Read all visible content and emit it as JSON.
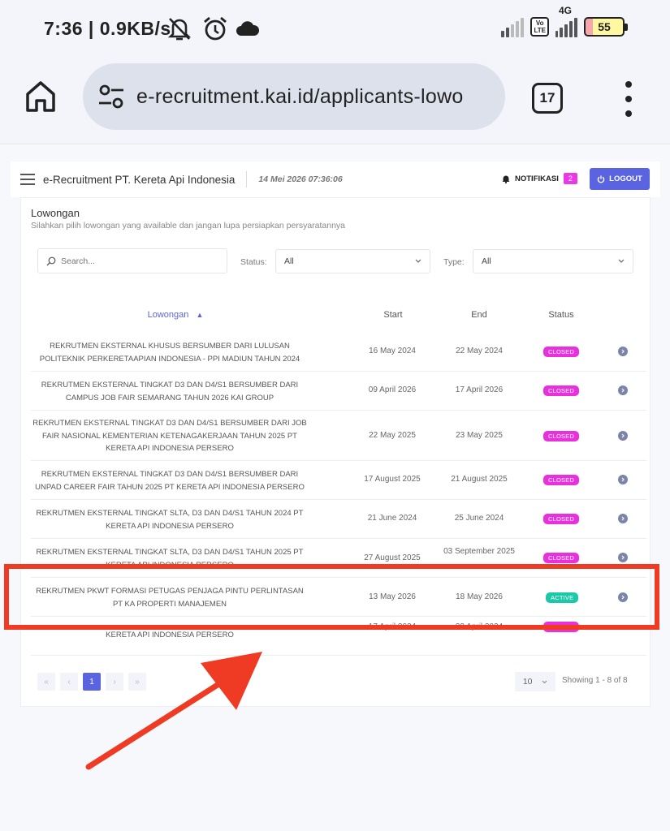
{
  "status_bar": {
    "time": "7:36",
    "speed": "0.9KB/s",
    "network": "4G",
    "volte": "Vo LTE",
    "battery": "55"
  },
  "browser": {
    "url": "e-recruitment.kai.id/applicants-lowo",
    "tab_count": "17"
  },
  "header": {
    "title": "e-Recruitment PT. Kereta Api Indonesia",
    "datetime": "14 Mei 2026 07:36:06",
    "notif_label": "NOTIFIKASI",
    "notif_count": "2",
    "logout_label": "LOGOUT"
  },
  "section": {
    "title": "Lowongan",
    "subtitle": "Silahkan pilih lowongan yang available dan jangan lupa persiapkan persyaratannya"
  },
  "filters": {
    "search_placeholder": "Search...",
    "status_label": "Status:",
    "status_value": "All",
    "type_label": "Type:",
    "type_value": "All"
  },
  "table": {
    "columns": {
      "name": "Lowongan",
      "start": "Start",
      "end": "End",
      "status": "Status"
    },
    "rows": [
      {
        "name": "REKRUTMEN EKSTERNAL KHUSUS BERSUMBER DARI LULUSAN POLITEKNIK PERKERETAAPIAN INDONESIA - PPI MADIUN TAHUN 2024",
        "start": "16 May 2024",
        "end": "22 May 2024",
        "status": "CLOSED"
      },
      {
        "name": "REKRUTMEN EKSTERNAL TINGKAT D3 DAN D4/S1 BERSUMBER DARI CAMPUS JOB FAIR SEMARANG TAHUN 2026 KAI GROUP",
        "start": "09 April 2026",
        "end": "17 April 2026",
        "status": "CLOSED"
      },
      {
        "name": "REKRUTMEN EKSTERNAL TINGKAT D3 DAN D4/S1 BERSUMBER DARI JOB FAIR NASIONAL KEMENTERIAN KETENAGAKERJAAN TAHUN 2025 PT KERETA API INDONESIA PERSERO",
        "start": "22 May 2025",
        "end": "23 May 2025",
        "status": "CLOSED"
      },
      {
        "name": "REKRUTMEN EKSTERNAL TINGKAT D3 DAN D4/S1 BERSUMBER DARI UNPAD CAREER FAIR TAHUN 2025 PT KERETA API INDONESIA PERSERO",
        "start": "17 August 2025",
        "end": "21 August 2025",
        "status": "CLOSED"
      },
      {
        "name": "REKRUTMEN EKSTERNAL TINGKAT SLTA, D3 DAN D4/S1 TAHUN 2024 PT KERETA API INDONESIA PERSERO",
        "start": "21 June 2024",
        "end": "25 June 2024",
        "status": "CLOSED"
      },
      {
        "name": "REKRUTMEN EKSTERNAL TINGKAT SLTA, D3 DAN D4/S1 TAHUN 2025 PT KERETA API INDONESIA PERSERO",
        "start": "27 August 2025",
        "end": "03 September 2025",
        "status": "CLOSED"
      },
      {
        "name": "REKRUTMEN PKWT FORMASI PETUGAS PENJAGA PINTU PERLINTASAN PT KA PROPERTI MANAJEMEN",
        "start": "13 May 2026",
        "end": "18 May 2026",
        "status": "ACTIVE"
      },
      {
        "name": "KERETA API INDONESIA PERSERO",
        "start": "17 April 2024",
        "end": "22 April 2024",
        "status": "CLOSED"
      }
    ]
  },
  "pagination": {
    "first": "«",
    "prev": "‹",
    "current": "1",
    "next": "›",
    "last": "»",
    "per_page": "10",
    "showing": "Showing 1 - 8 of 8"
  },
  "colors": {
    "accent": "#5a63e0",
    "closed": "#e831dd",
    "active": "#1dc8a8",
    "annotation": "#ef3b24"
  }
}
